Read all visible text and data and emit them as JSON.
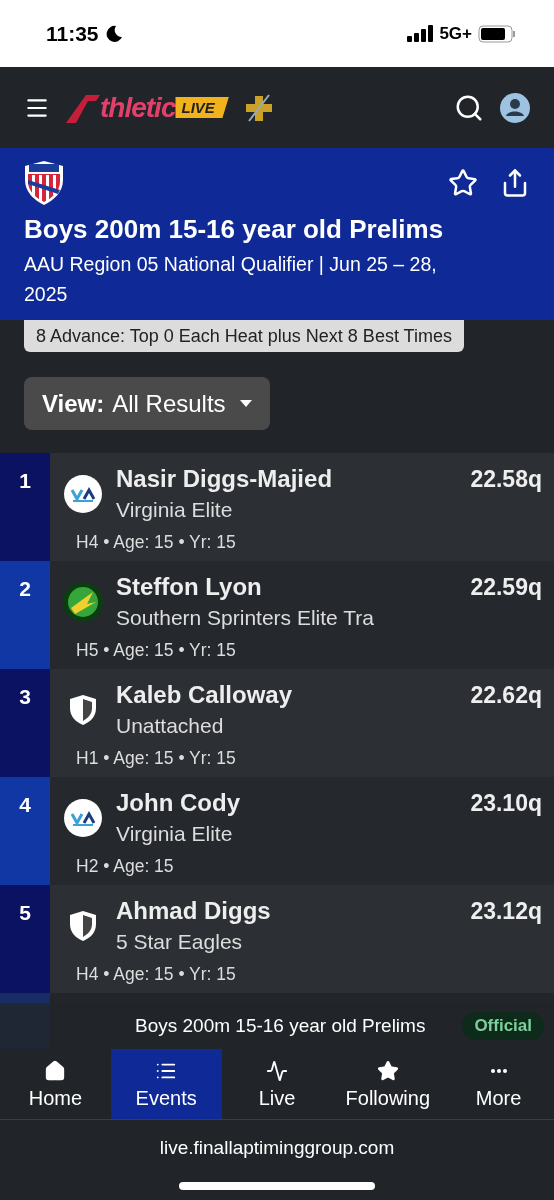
{
  "status_bar": {
    "time": "11:35",
    "network": "5G+"
  },
  "header": {
    "logo_word": "thletic",
    "logo_badge": "LIVE"
  },
  "event": {
    "title": "Boys 200m 15-16 year old Prelims",
    "subtitle": "AAU Region 05 National Qualifier | Jun 25 – 28, 2025",
    "advance": "8 Advance: Top 0 Each Heat plus Next 8 Best Times"
  },
  "view": {
    "label": "View:",
    "value": "All Results"
  },
  "results": [
    {
      "place": "1",
      "name": "Nasir Diggs-Majied",
      "team": "Virginia Elite",
      "time": "22.58q",
      "meta": "H4 • Age: 15 • Yr: 15",
      "kind": "emblem"
    },
    {
      "place": "2",
      "name": "Steffon Lyon",
      "team": "Southern Sprinters Elite Tra",
      "time": "22.59q",
      "meta": "H5 • Age: 15 • Yr: 15",
      "kind": "badge"
    },
    {
      "place": "3",
      "name": "Kaleb Calloway",
      "team": "Unattached",
      "time": "22.62q",
      "meta": "H1 • Age: 15 • Yr: 15",
      "kind": "shield"
    },
    {
      "place": "4",
      "name": "John Cody",
      "team": "Virginia Elite",
      "time": "23.10q",
      "meta": "H2 • Age: 15",
      "kind": "emblem"
    },
    {
      "place": "5",
      "name": "Ahmad Diggs",
      "team": "5 Star Eagles",
      "time": "23.12q",
      "meta": "H4 • Age: 15 • Yr: 15",
      "kind": "shield"
    }
  ],
  "now_showing": {
    "title": "Boys 200m 15-16 year old Prelims",
    "status": "Official"
  },
  "tabs": [
    {
      "label": "Home",
      "kind": "home",
      "selected": false
    },
    {
      "label": "Events",
      "kind": "list",
      "selected": true
    },
    {
      "label": "Live",
      "kind": "pulse",
      "selected": false
    },
    {
      "label": "Following",
      "kind": "star",
      "selected": false
    },
    {
      "label": "More",
      "kind": "more",
      "selected": false
    }
  ],
  "browser": {
    "url": "live.finallaptiminggroup.com"
  }
}
